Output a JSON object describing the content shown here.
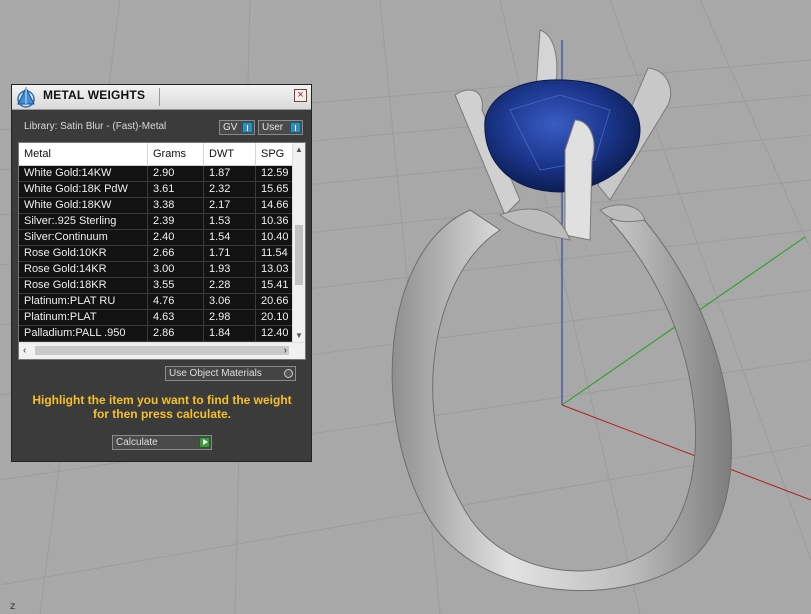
{
  "panel": {
    "title": "METAL WEIGHTS",
    "close_label": "×",
    "library_label": "Library: Satin Blur - (Fast)-Metal",
    "toggles": {
      "gv": "GV",
      "user": "User"
    },
    "columns": [
      "Metal",
      "Grams",
      "DWT",
      "SPG"
    ],
    "rows": [
      [
        "White Gold:14KW",
        "2.90",
        "1.87",
        "12.59"
      ],
      [
        "White Gold:18K PdW",
        "3.61",
        "2.32",
        "15.65"
      ],
      [
        "White Gold:18KW",
        "3.38",
        "2.17",
        "14.66"
      ],
      [
        "Silver:.925 Sterling",
        "2.39",
        "1.53",
        "10.36"
      ],
      [
        "Silver:Continuum",
        "2.40",
        "1.54",
        "10.40"
      ],
      [
        "Rose Gold:10KR",
        "2.66",
        "1.71",
        "11.54"
      ],
      [
        "Rose Gold:14KR",
        "3.00",
        "1.93",
        "13.03"
      ],
      [
        "Rose Gold:18KR",
        "3.55",
        "2.28",
        "15.41"
      ],
      [
        "Platinum:PLAT RU",
        "4.76",
        "3.06",
        "20.66"
      ],
      [
        "Platinum:PLAT",
        "4.63",
        "2.98",
        "20.10"
      ],
      [
        "Palladium:PALL .950",
        "2.86",
        "1.84",
        "12.40"
      ]
    ],
    "use_object_materials": "Use Object Materials",
    "instructions_line1": "Highlight the item you want to find the weight",
    "instructions_line2": "for then press calculate.",
    "calculate_label": "Calculate"
  },
  "viewport": {
    "axis_label": "z",
    "gem_color": "#1b3a8a",
    "metal_color": "#c9c9c9",
    "grid_color": "#9a9a9a",
    "axis_colors": {
      "x": "#b02020",
      "y": "#20a020",
      "z": "#2020b0"
    }
  }
}
